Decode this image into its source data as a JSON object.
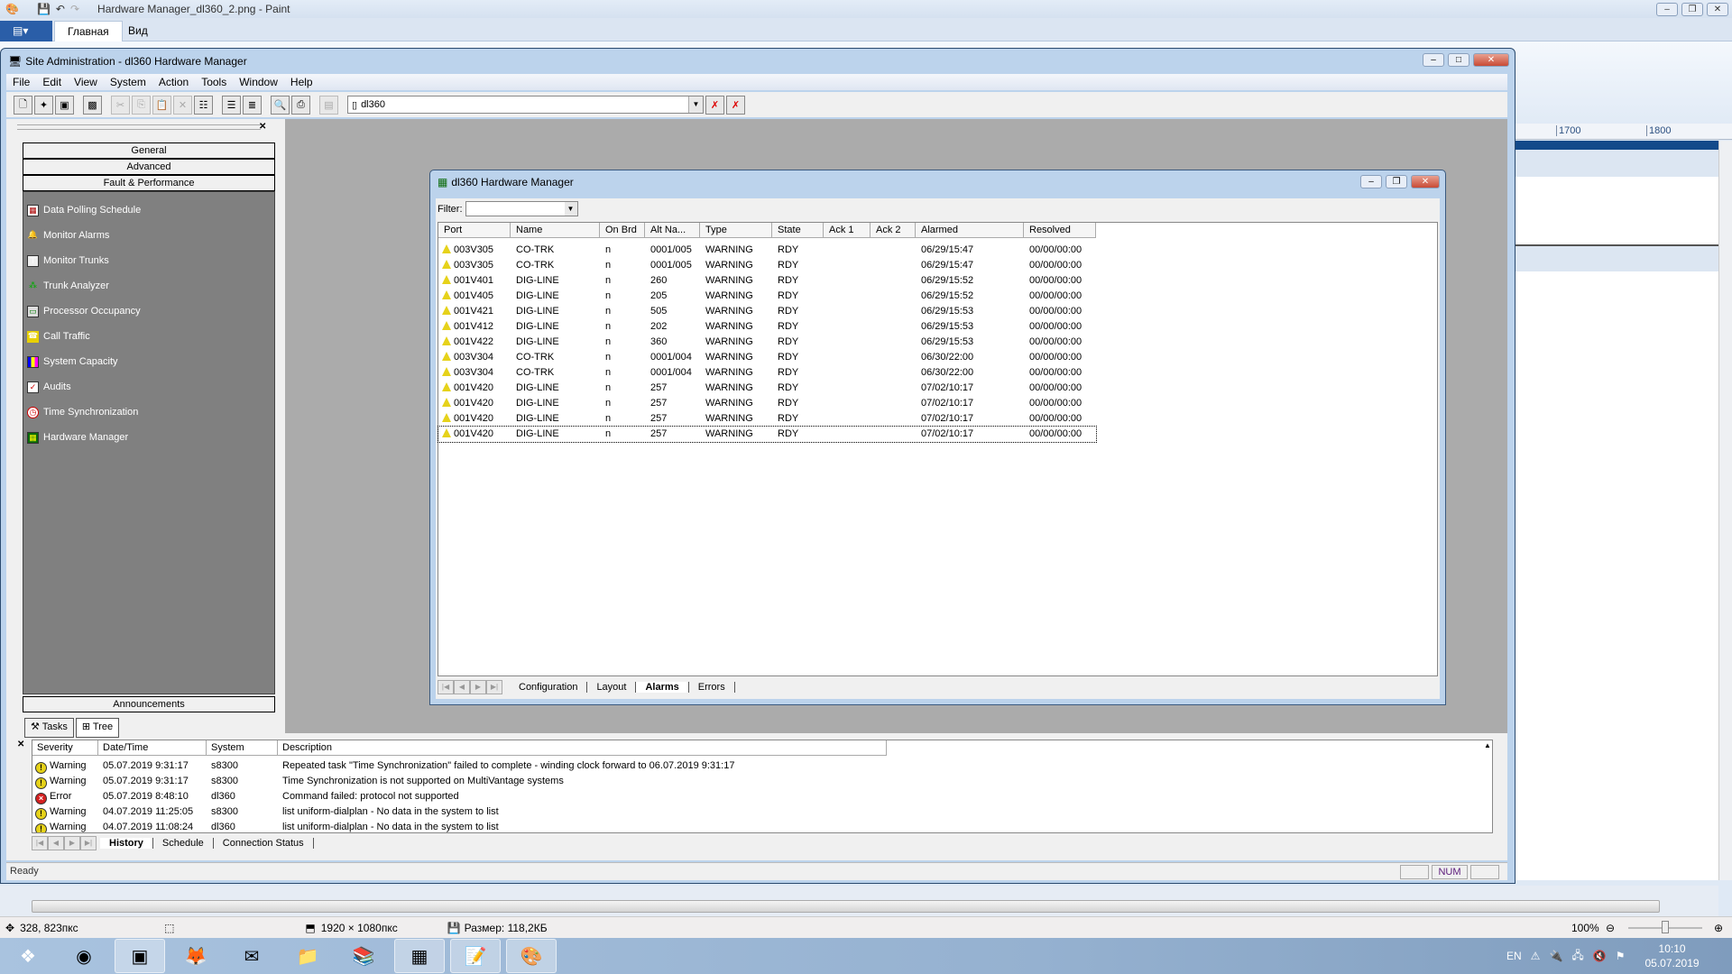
{
  "paint": {
    "title": "Hardware Manager_dl360_2.png - Paint",
    "tabs": [
      "Главная",
      "Вид"
    ],
    "ruler": [
      "1700",
      "1800"
    ],
    "status": {
      "cursor": "328, 823пкс",
      "dimensions": "1920 × 1080пкс",
      "size": "Размер: 118,2КБ",
      "zoom": "100%"
    }
  },
  "main": {
    "title": "Site Administration - dl360 Hardware Manager",
    "menu": [
      "File",
      "Edit",
      "View",
      "System",
      "Action",
      "Tools",
      "Window",
      "Help"
    ],
    "system_combo": "dl360",
    "status": {
      "ready": "Ready",
      "num": "NUM"
    }
  },
  "left_panel": {
    "groups": [
      "General",
      "Advanced",
      "Fault & Performance"
    ],
    "items": [
      {
        "label": "Data Polling Schedule",
        "icon": "calendar-icon"
      },
      {
        "label": "Monitor Alarms",
        "icon": "bell-icon"
      },
      {
        "label": "Monitor Trunks",
        "icon": "trunk-icon"
      },
      {
        "label": "Trunk Analyzer",
        "icon": "analyzer-icon"
      },
      {
        "label": "Processor Occupancy",
        "icon": "computer-icon"
      },
      {
        "label": "Call Traffic",
        "icon": "phone-icon"
      },
      {
        "label": "System Capacity",
        "icon": "bar-chart-icon"
      },
      {
        "label": "Audits",
        "icon": "checklist-icon"
      },
      {
        "label": "Time Synchronization",
        "icon": "clock-icon"
      },
      {
        "label": "Hardware Manager",
        "icon": "circuit-board-icon"
      }
    ],
    "announcements": "Announcements",
    "tabs": [
      "Tasks",
      "Tree"
    ]
  },
  "child": {
    "title": "dl360 Hardware Manager",
    "filter_label": "Filter:",
    "filter_value": "",
    "columns": [
      "Port",
      "Name",
      "On Brd",
      "Alt Na...",
      "Type",
      "State",
      "Ack 1",
      "Ack 2",
      "Alarmed",
      "Resolved"
    ],
    "rows": [
      [
        "003V305",
        "CO-TRK",
        "n",
        "0001/005",
        "WARNING",
        "RDY",
        "",
        "",
        "06/29/15:47",
        "00/00/00:00"
      ],
      [
        "003V305",
        "CO-TRK",
        "n",
        "0001/005",
        "WARNING",
        "RDY",
        "",
        "",
        "06/29/15:47",
        "00/00/00:00"
      ],
      [
        "001V401",
        "DIG-LINE",
        "n",
        "260",
        "WARNING",
        "RDY",
        "",
        "",
        "06/29/15:52",
        "00/00/00:00"
      ],
      [
        "001V405",
        "DIG-LINE",
        "n",
        "205",
        "WARNING",
        "RDY",
        "",
        "",
        "06/29/15:52",
        "00/00/00:00"
      ],
      [
        "001V421",
        "DIG-LINE",
        "n",
        "505",
        "WARNING",
        "RDY",
        "",
        "",
        "06/29/15:53",
        "00/00/00:00"
      ],
      [
        "001V412",
        "DIG-LINE",
        "n",
        "202",
        "WARNING",
        "RDY",
        "",
        "",
        "06/29/15:53",
        "00/00/00:00"
      ],
      [
        "001V422",
        "DIG-LINE",
        "n",
        "360",
        "WARNING",
        "RDY",
        "",
        "",
        "06/29/15:53",
        "00/00/00:00"
      ],
      [
        "003V304",
        "CO-TRK",
        "n",
        "0001/004",
        "WARNING",
        "RDY",
        "",
        "",
        "06/30/22:00",
        "00/00/00:00"
      ],
      [
        "003V304",
        "CO-TRK",
        "n",
        "0001/004",
        "WARNING",
        "RDY",
        "",
        "",
        "06/30/22:00",
        "00/00/00:00"
      ],
      [
        "001V420",
        "DIG-LINE",
        "n",
        "257",
        "WARNING",
        "RDY",
        "",
        "",
        "07/02/10:17",
        "00/00/00:00"
      ],
      [
        "001V420",
        "DIG-LINE",
        "n",
        "257",
        "WARNING",
        "RDY",
        "",
        "",
        "07/02/10:17",
        "00/00/00:00"
      ],
      [
        "001V420",
        "DIG-LINE",
        "n",
        "257",
        "WARNING",
        "RDY",
        "",
        "",
        "07/02/10:17",
        "00/00/00:00"
      ],
      [
        "001V420",
        "DIG-LINE",
        "n",
        "257",
        "WARNING",
        "RDY",
        "",
        "",
        "07/02/10:17",
        "00/00/00:00"
      ]
    ],
    "tabs": [
      "Configuration",
      "Layout",
      "Alarms",
      "Errors"
    ],
    "active_tab": "Alarms"
  },
  "output": {
    "columns": [
      "Severity",
      "Date/Time",
      "System",
      "Description"
    ],
    "rows": [
      [
        "Warning",
        "05.07.2019 9:31:17",
        "s8300",
        "Repeated task \"Time Synchronization\" failed to complete - winding clock forward to 06.07.2019 9:31:17"
      ],
      [
        "Warning",
        "05.07.2019 9:31:17",
        "s8300",
        "Time Synchronization is not supported on MultiVantage systems"
      ],
      [
        "Error",
        "05.07.2019 8:48:10",
        "dl360",
        "Command failed: protocol not supported"
      ],
      [
        "Warning",
        "04.07.2019 11:25:05",
        "s8300",
        "list uniform-dialplan - No data in the system to list"
      ],
      [
        "Warning",
        "04.07.2019 11:08:24",
        "dl360",
        "list uniform-dialplan - No data in the system to list"
      ]
    ],
    "tabs": [
      "History",
      "Schedule",
      "Connection Status"
    ],
    "active_tab": "History"
  },
  "taskbar": {
    "apps": [
      "start",
      "chrome",
      "site-administration",
      "firefox",
      "thunderbird",
      "explorer",
      "winrar",
      "libreoffice-calc",
      "notepad",
      "paint"
    ],
    "tray": {
      "lang": "EN",
      "time": "10:10",
      "date": "05.07.2019"
    }
  },
  "colors": {
    "warning": "#e6d21a",
    "error": "#d42020",
    "mdi_bg": "#ababab",
    "panel_bg": "#808080"
  }
}
